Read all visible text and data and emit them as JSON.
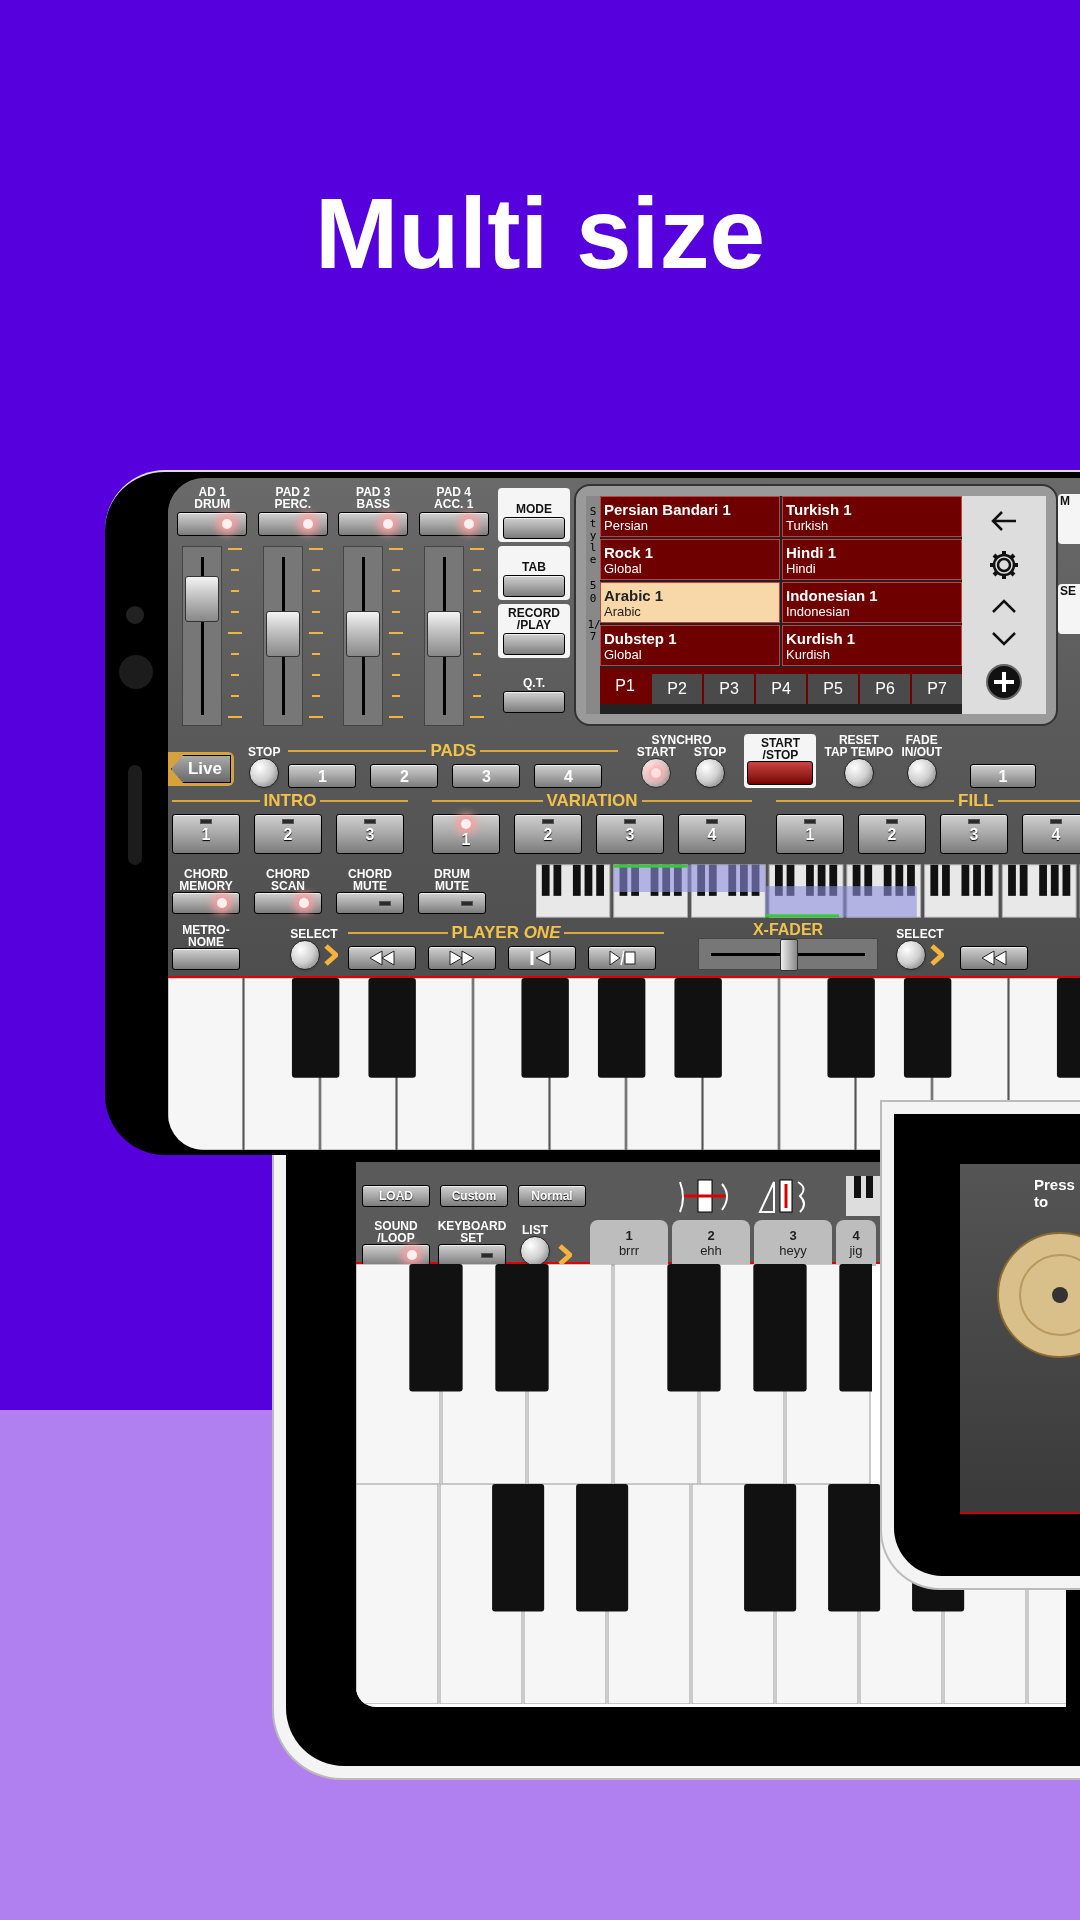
{
  "headline": "Multi size",
  "main_phone": {
    "pad_channels": [
      {
        "label": "AD 1\nDRUM",
        "lit": true,
        "level": 0.78
      },
      {
        "label": "PAD 2\nPERC.",
        "lit": true,
        "level": 0.52
      },
      {
        "label": "PAD 3\nBASS",
        "lit": true,
        "level": 0.52
      },
      {
        "label": "PAD 4\nACC. 1",
        "lit": true,
        "level": 0.52
      }
    ],
    "side_buttons": [
      {
        "label": "MODE",
        "kind": "card"
      },
      {
        "label": "TAB",
        "kind": "card"
      },
      {
        "label": "RECORD\n/PLAY",
        "kind": "card"
      },
      {
        "label": "Q.T.",
        "kind": "bare"
      }
    ],
    "style_browser": {
      "side_label": "Style",
      "count": "50",
      "page_info": "1/7",
      "styles": [
        {
          "name": "Persian Bandari 1",
          "category": "Persian",
          "selected": false
        },
        {
          "name": "Turkish 1",
          "category": "Turkish",
          "selected": false
        },
        {
          "name": "Rock 1",
          "category": "Global",
          "selected": false
        },
        {
          "name": "Hindi 1",
          "category": "Hindi",
          "selected": false
        },
        {
          "name": "Arabic 1",
          "category": "Arabic",
          "selected": true
        },
        {
          "name": "Indonesian 1",
          "category": "Indonesian",
          "selected": false
        },
        {
          "name": "Dubstep 1",
          "category": "Global",
          "selected": false
        },
        {
          "name": "Kurdish 1",
          "category": "Kurdish",
          "selected": false
        }
      ],
      "pages": [
        {
          "label": "P1",
          "selected": true
        },
        {
          "label": "P2",
          "selected": false
        },
        {
          "label": "P3",
          "selected": false
        },
        {
          "label": "P4",
          "selected": false
        },
        {
          "label": "P5",
          "selected": false
        },
        {
          "label": "P6",
          "selected": false
        },
        {
          "label": "P7",
          "selected": false
        }
      ]
    },
    "right_edge_buttons": [
      "M",
      "SE"
    ],
    "live_button": "Live",
    "stop_label": "STOP",
    "pads_header": "PADS",
    "pad_buttons": [
      "1",
      "2",
      "3",
      "4"
    ],
    "synchro": {
      "label": "SYNCHRO",
      "start": "START",
      "stop": "STOP",
      "start_lit": true
    },
    "start_stop": "START\n/STOP",
    "reset_label": "RESET\nTAP TEMPO",
    "fade_label": "FADE\nIN/OUT",
    "edge_pad_button": "1",
    "sections": [
      {
        "title": "INTRO",
        "buttons": [
          {
            "label": "1",
            "lit": false
          },
          {
            "label": "2",
            "lit": false
          },
          {
            "label": "3",
            "lit": false
          }
        ]
      },
      {
        "title": "VARIATION",
        "buttons": [
          {
            "label": "1",
            "lit": true
          },
          {
            "label": "2",
            "lit": false
          },
          {
            "label": "3",
            "lit": false
          },
          {
            "label": "4",
            "lit": false
          }
        ]
      },
      {
        "title": "FILL",
        "buttons": [
          {
            "label": "1",
            "lit": false
          },
          {
            "label": "2",
            "lit": false
          },
          {
            "label": "3",
            "lit": false
          },
          {
            "label": "4",
            "lit": false
          }
        ]
      }
    ],
    "chord_buttons": [
      {
        "label": "CHORD\nMEMORY",
        "lit": true
      },
      {
        "label": "CHORD\nSCAN",
        "lit": true
      },
      {
        "label": "CHORD\nMUTE",
        "lit": false
      },
      {
        "label": "DRUM\nMUTE",
        "lit": false
      }
    ],
    "metronome": "METRO-\nNOME",
    "select_left": "SELECT",
    "player_title": "PLAYER *ONE*",
    "xfader": {
      "label": "X-FADER",
      "level": 0.5
    },
    "select_right": "SELECT"
  },
  "second_phone": {
    "buttons": [
      "LOAD",
      "Custom",
      "Normal"
    ],
    "toggles": [
      {
        "label": "SOUND\n/LOOP",
        "lit": true
      },
      {
        "label": "KEYBOARD\nSET",
        "lit": false
      }
    ],
    "list_label": "LIST",
    "slots": [
      {
        "number": "1",
        "name": "brrr"
      },
      {
        "number": "2",
        "name": "ehh"
      },
      {
        "number": "3",
        "name": "heyy"
      },
      {
        "number": "4",
        "name": "jig"
      }
    ]
  },
  "tablet": {
    "prompt": "Press\nto"
  }
}
